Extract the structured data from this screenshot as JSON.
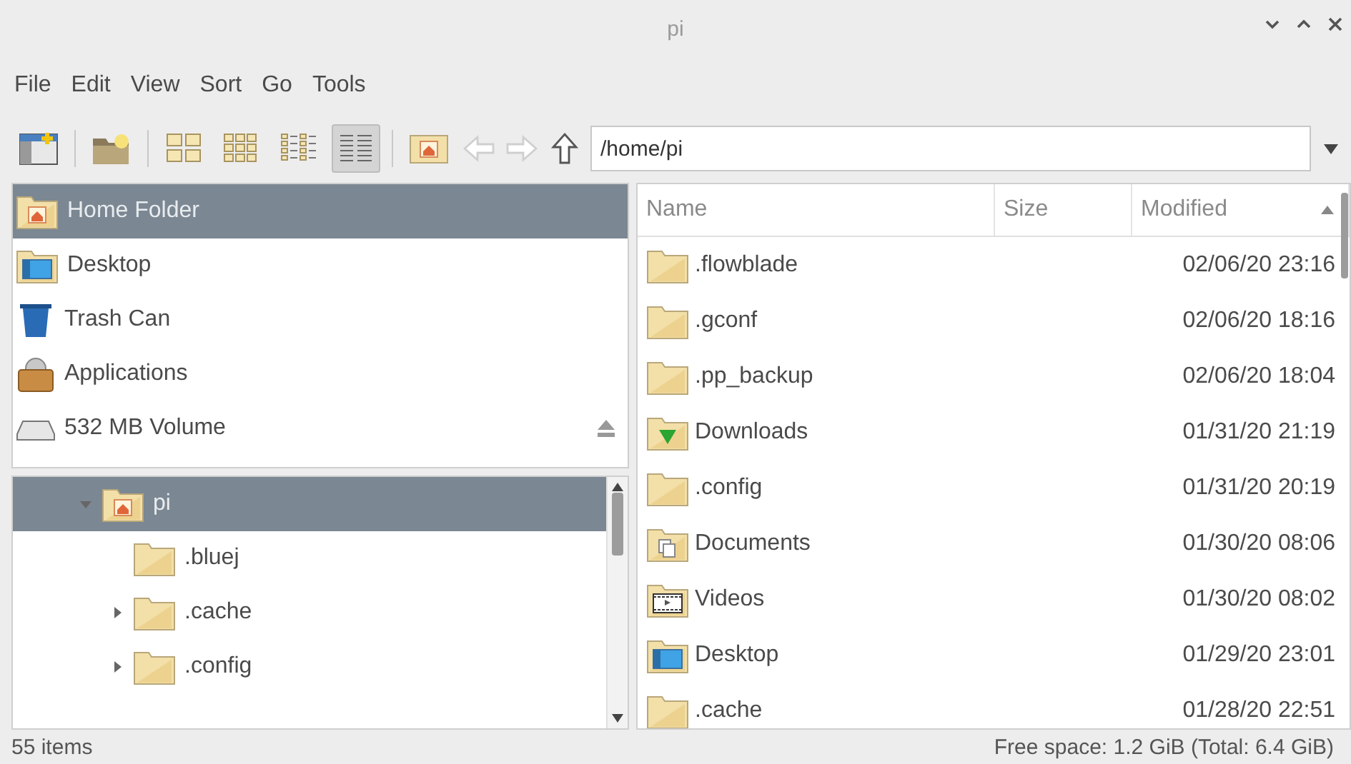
{
  "window": {
    "title": "pi"
  },
  "menu": [
    "File",
    "Edit",
    "View",
    "Sort",
    "Go",
    "Tools"
  ],
  "toolbar": {
    "views": [
      {
        "kind": "icons",
        "selected": false
      },
      {
        "kind": "thumbs",
        "selected": false
      },
      {
        "kind": "compact",
        "selected": false
      },
      {
        "kind": "list",
        "selected": true
      }
    ],
    "back_disabled": true,
    "forward_disabled": true,
    "path": "/home/pi"
  },
  "places": [
    {
      "kind": "home",
      "label": "Home Folder",
      "selected": true
    },
    {
      "kind": "desktop",
      "label": "Desktop",
      "selected": false
    },
    {
      "kind": "trash",
      "label": "Trash Can",
      "selected": false
    },
    {
      "kind": "apps",
      "label": "Applications",
      "selected": false
    },
    {
      "kind": "drive",
      "label": "532 MB Volume",
      "selected": false,
      "ejectable": true
    }
  ],
  "tree": [
    {
      "label": "pi",
      "kind": "home",
      "selected": true,
      "expanded": true,
      "children": [
        {
          "label": ".bluej",
          "selected": false,
          "expandable": false
        },
        {
          "label": ".cache",
          "selected": false,
          "expandable": true,
          "expanded": false
        },
        {
          "label": ".config",
          "selected": false,
          "expandable": true,
          "expanded": false
        }
      ]
    }
  ],
  "files": {
    "columns": [
      "Name",
      "Size",
      "Modified"
    ],
    "rows": [
      {
        "kind": "folder",
        "name": ".flowblade",
        "modified": "02/06/20 23:16"
      },
      {
        "kind": "folder",
        "name": ".gconf",
        "modified": "02/06/20 18:16"
      },
      {
        "kind": "folder",
        "name": ".pp_backup",
        "modified": "02/06/20 18:04"
      },
      {
        "kind": "downloads",
        "name": "Downloads",
        "modified": "01/31/20 21:19"
      },
      {
        "kind": "folder",
        "name": ".config",
        "modified": "01/31/20 20:19"
      },
      {
        "kind": "documents",
        "name": "Documents",
        "modified": "01/30/20 08:06"
      },
      {
        "kind": "videos",
        "name": "Videos",
        "modified": "01/30/20 08:02"
      },
      {
        "kind": "desktop",
        "name": "Desktop",
        "modified": "01/29/20 23:01"
      },
      {
        "kind": "folder",
        "name": ".cache",
        "modified": "01/28/20 22:51"
      }
    ]
  },
  "status": {
    "items": "55 items",
    "free": "Free space: 1.2 GiB (Total: 6.4 GiB)"
  }
}
